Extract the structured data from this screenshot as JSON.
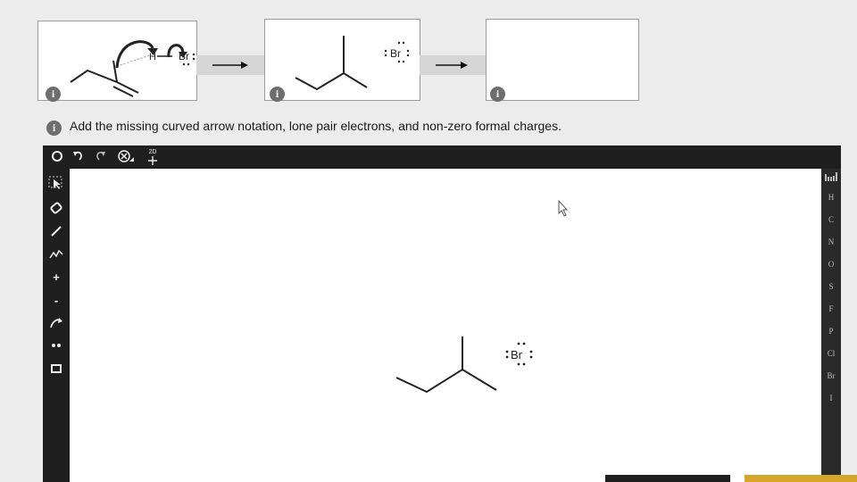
{
  "mechanism": {
    "reactant_reagent": "Br",
    "reactant_h": "H",
    "middle_ion": "Br",
    "info_badge": "i"
  },
  "instruction": {
    "badge": "i",
    "text": "Add the missing curved arrow notation, lone pair electrons, and non-zero formal charges."
  },
  "editor": {
    "top_tools": [
      "reset-icon",
      "undo-icon",
      "redo-icon",
      "zoom-icon",
      "2d-icon"
    ],
    "two_d_label": "2D",
    "left_tools": [
      "select-icon",
      "eraser-icon",
      "bond-icon",
      "chain-icon",
      "plus-charge-icon",
      "minus-charge-icon",
      "arrow-icon",
      "lone-pair-icon",
      "box-icon"
    ],
    "elements": [
      "H",
      "C",
      "N",
      "O",
      "S",
      "F",
      "P",
      "Cl",
      "Br",
      "I"
    ],
    "canvas_ion": "Br",
    "colors": {
      "toolbar": "#1f1f1f",
      "canvas": "#ffffff",
      "accent": "#d4a62a"
    }
  }
}
